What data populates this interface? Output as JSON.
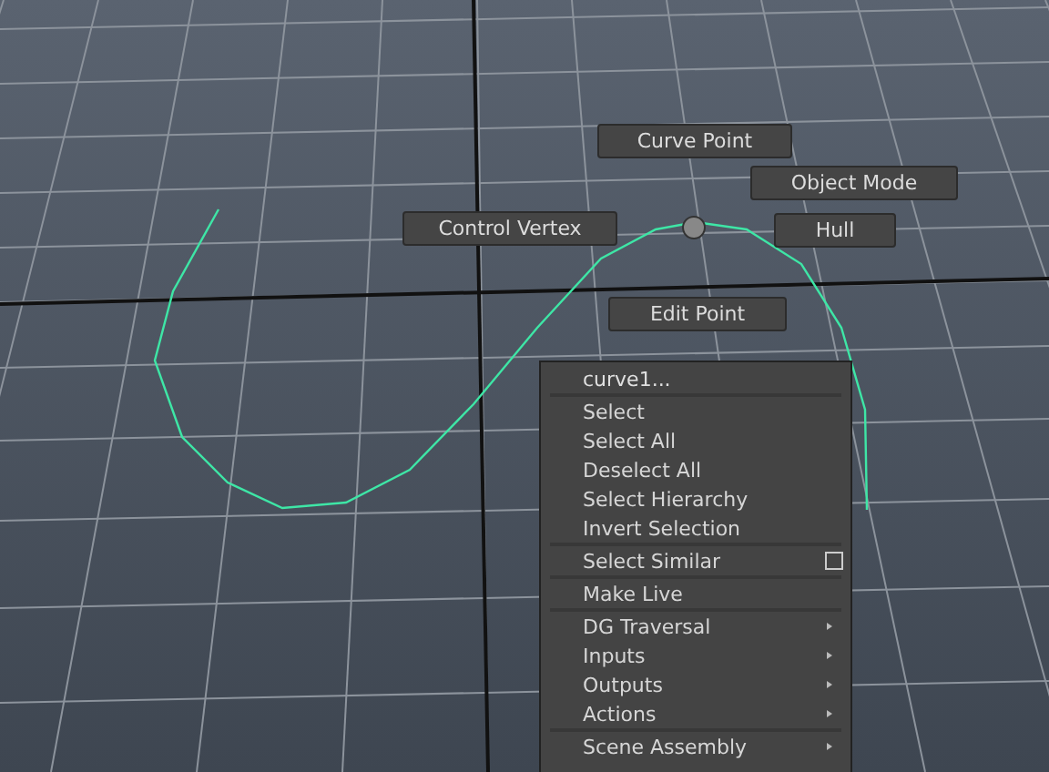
{
  "marking_menu": [
    {
      "label": "Curve Point"
    },
    {
      "label": "Object Mode"
    },
    {
      "label": "Control Vertex"
    },
    {
      "label": "Hull"
    },
    {
      "label": "Edit Point"
    }
  ],
  "context_menu": [
    {
      "kind": "title",
      "label": "curve1..."
    },
    {
      "kind": "separator"
    },
    {
      "kind": "item",
      "label": "Select",
      "submenu": false,
      "option_box": false
    },
    {
      "kind": "item",
      "label": "Select All",
      "submenu": false,
      "option_box": false
    },
    {
      "kind": "item",
      "label": "Deselect All",
      "submenu": false,
      "option_box": false
    },
    {
      "kind": "item",
      "label": "Select Hierarchy",
      "submenu": false,
      "option_box": false
    },
    {
      "kind": "item",
      "label": "Invert Selection",
      "submenu": false,
      "option_box": false
    },
    {
      "kind": "separator"
    },
    {
      "kind": "item",
      "label": "Select Similar",
      "submenu": false,
      "option_box": true
    },
    {
      "kind": "separator"
    },
    {
      "kind": "item",
      "label": "Make Live",
      "submenu": false,
      "option_box": false
    },
    {
      "kind": "separator"
    },
    {
      "kind": "item",
      "label": "DG Traversal",
      "submenu": true,
      "option_box": false
    },
    {
      "kind": "item",
      "label": "Inputs",
      "submenu": true,
      "option_box": false
    },
    {
      "kind": "item",
      "label": "Outputs",
      "submenu": true,
      "option_box": false
    },
    {
      "kind": "item",
      "label": "Actions",
      "submenu": true,
      "option_box": false
    },
    {
      "kind": "separator"
    },
    {
      "kind": "item",
      "label": "Scene Assembly",
      "submenu": true,
      "option_box": false
    }
  ]
}
